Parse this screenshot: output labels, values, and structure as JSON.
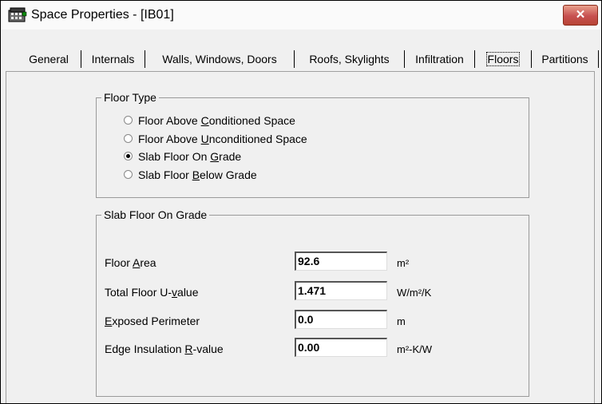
{
  "window": {
    "title": "Space Properties - [IB01]",
    "close_label": "✕"
  },
  "tabs": [
    {
      "label": "General",
      "active": false
    },
    {
      "label": "Internals",
      "active": false
    },
    {
      "label": "Walls, Windows, Doors",
      "active": false
    },
    {
      "label": "Roofs, Skylights",
      "active": false
    },
    {
      "label": "Infiltration",
      "active": false
    },
    {
      "label": "Floors",
      "active": true
    },
    {
      "label": "Partitions",
      "active": false
    }
  ],
  "floor_type": {
    "legend": "Floor Type",
    "options": [
      {
        "pre": "Floor Above ",
        "key": "C",
        "post": "onditioned Space",
        "checked": false
      },
      {
        "pre": "Floor Above ",
        "key": "U",
        "post": "nconditioned Space",
        "checked": false
      },
      {
        "pre": "Slab Floor On ",
        "key": "G",
        "post": "rade",
        "checked": true
      },
      {
        "pre": "Slab Floor ",
        "key": "B",
        "post": "elow Grade",
        "checked": false
      }
    ]
  },
  "slab": {
    "legend": "Slab Floor On Grade",
    "fields": [
      {
        "pre": "Floor ",
        "key": "A",
        "post": "rea",
        "value": "92.6",
        "unit": "m²"
      },
      {
        "pre": "Total Floor U-",
        "key": "v",
        "post": "alue",
        "value": "1.471",
        "unit": "W/m²/K"
      },
      {
        "pre": "",
        "key": "E",
        "post": "xposed Perimeter",
        "value": "0.0",
        "unit": "m"
      },
      {
        "pre": "Edge Insulation ",
        "key": "R",
        "post": "-value",
        "value": "0.00",
        "unit": "m²-K/W"
      }
    ]
  }
}
